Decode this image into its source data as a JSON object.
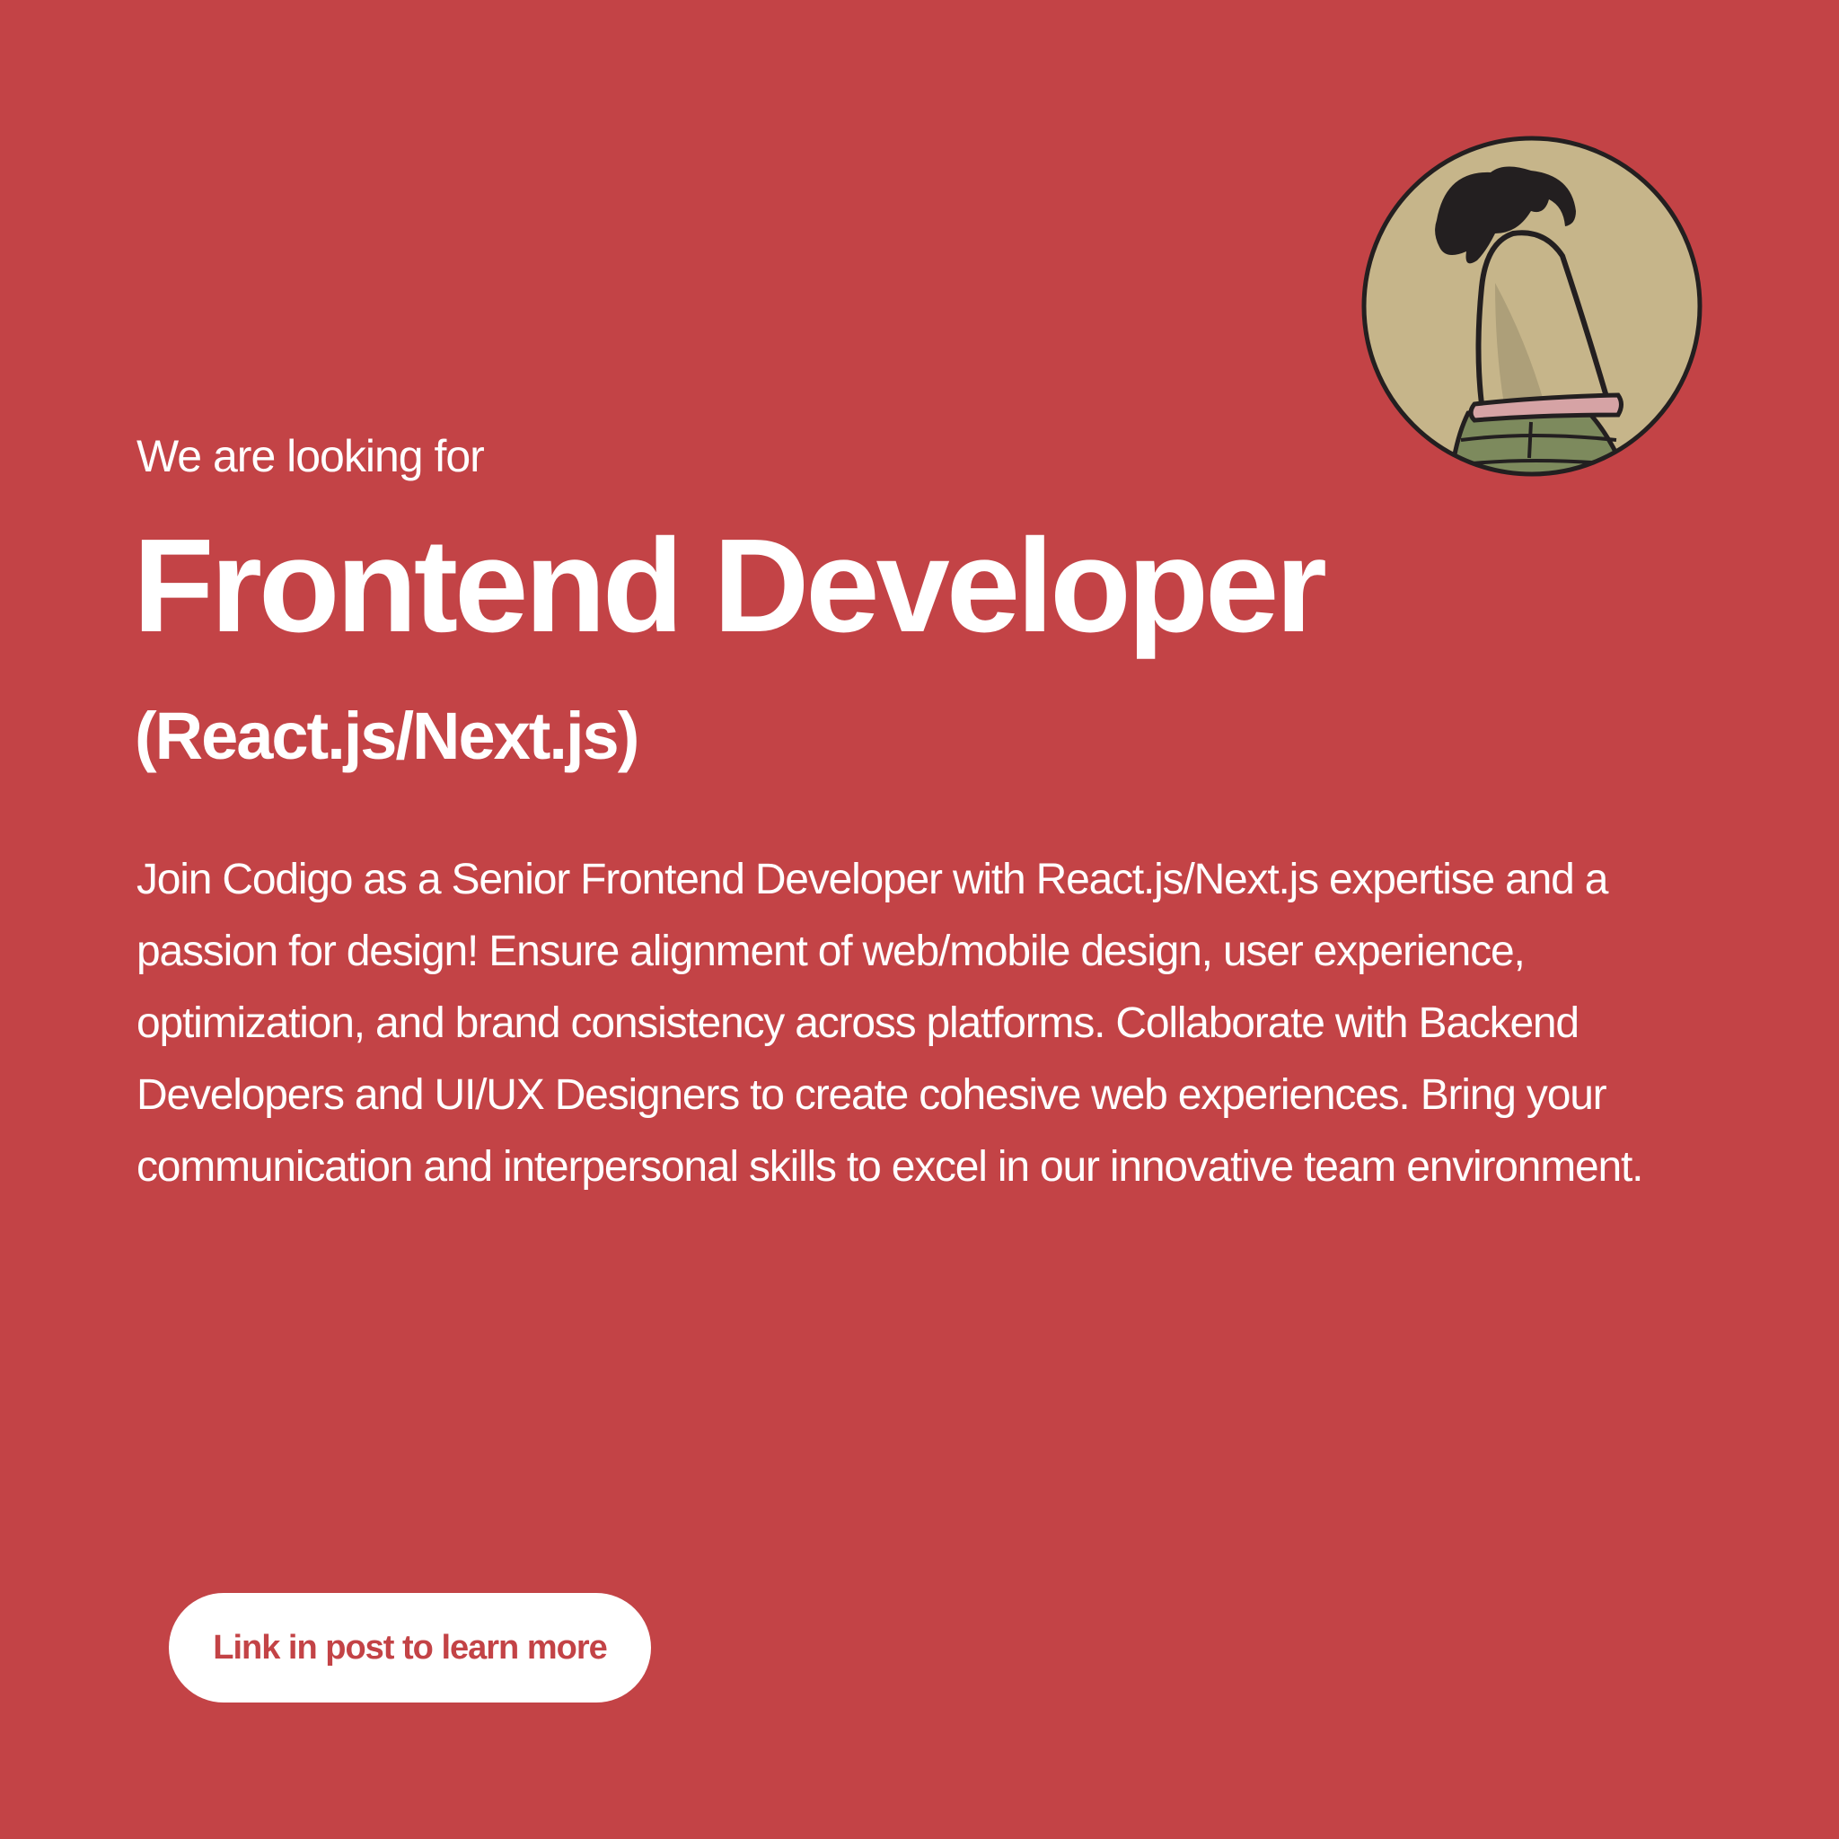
{
  "eyebrow": "We are looking for",
  "title": "Frontend Developer",
  "subtitle": "(React.js/Next.js)",
  "description": "Join Codigo as a Senior Frontend Developer with React.js/Next.js expertise and a passion for design! Ensure alignment of web/mobile design, user experience, optimization, and brand consistency across platforms. Collaborate with Backend Developers and UI/UX Designers to create cohesive web experiences. Bring your communication and interpersonal skills to excel in our innovative team environment.",
  "cta_label": "Link in post to learn more",
  "avatar_icon": "cartoon-character-avatar-icon",
  "colors": {
    "background": "#c34346",
    "text": "#ffffff",
    "button_bg": "#ffffff",
    "button_text": "#c34346",
    "avatar_bg": "#c6b58a"
  }
}
